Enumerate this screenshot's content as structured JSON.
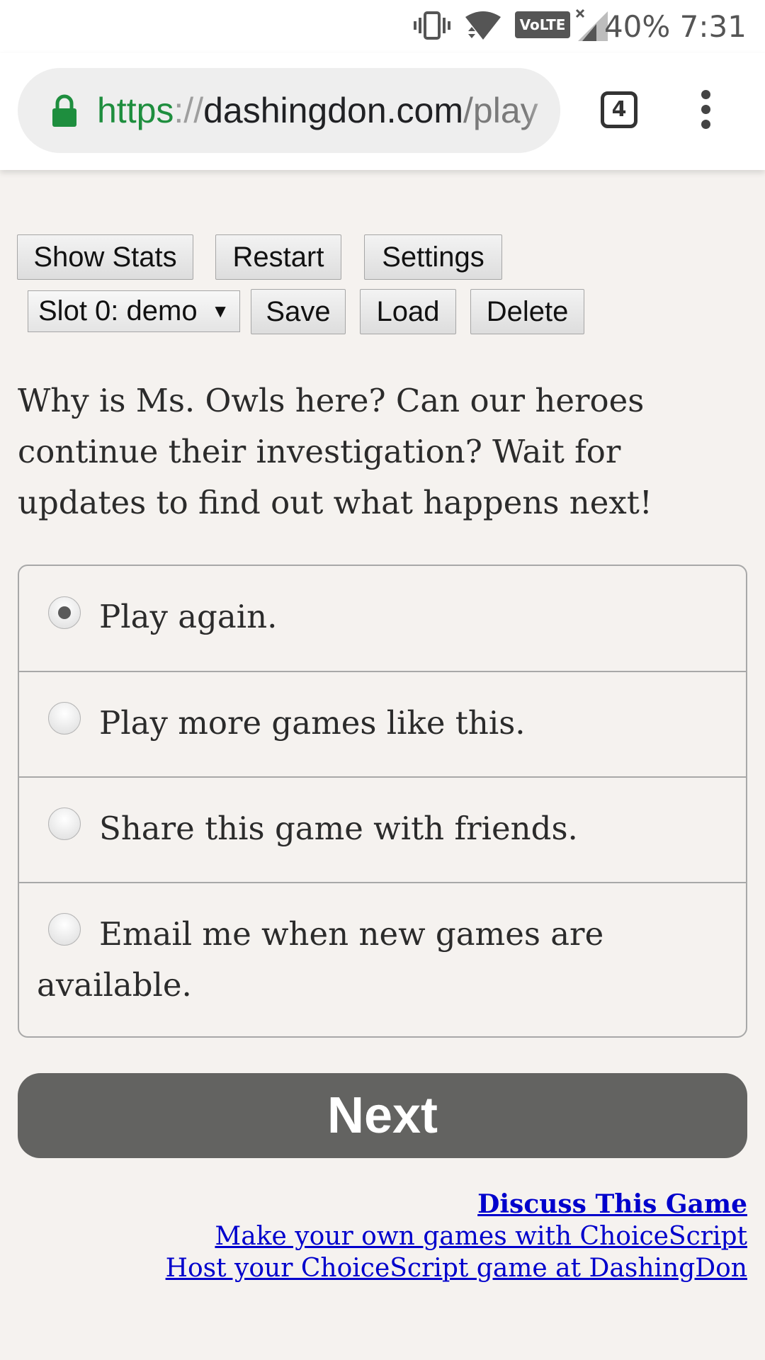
{
  "status_bar": {
    "battery": "40%",
    "time": "7:31",
    "volte_label": "VoLTE",
    "icons": [
      "vibrate-icon",
      "wifi-icon",
      "volte-icon",
      "signal-icon"
    ]
  },
  "browser": {
    "url_scheme": "https",
    "url_separator": "://",
    "url_host": "dashingdon.com",
    "url_path": "/play",
    "tab_count": "4",
    "colors": {
      "secure": "#1e8e3e"
    }
  },
  "toolbar": {
    "show_stats": "Show Stats",
    "restart": "Restart",
    "settings": "Settings",
    "slot_selected": "Slot 0: demo",
    "save": "Save",
    "load": "Load",
    "delete": "Delete"
  },
  "story": {
    "text": "Why is Ms. Owls here? Can our heroes continue their investigation? Wait for updates to find out what happens next!"
  },
  "choices": [
    {
      "label": "Play again.",
      "selected": true
    },
    {
      "label": "Play more games like this.",
      "selected": false
    },
    {
      "label": "Share this game with friends.",
      "selected": false
    },
    {
      "label": "Email me when new games are available.",
      "selected": false
    }
  ],
  "next_label": "Next",
  "footer": {
    "discuss": "Discuss This Game",
    "make": "Make your own games with ChoiceScript",
    "host": "Host your ChoiceScript game at DashingDon"
  },
  "colors": {
    "page_background": "#f5f2ef",
    "next_button": "#636361",
    "link": "#0000cc"
  }
}
